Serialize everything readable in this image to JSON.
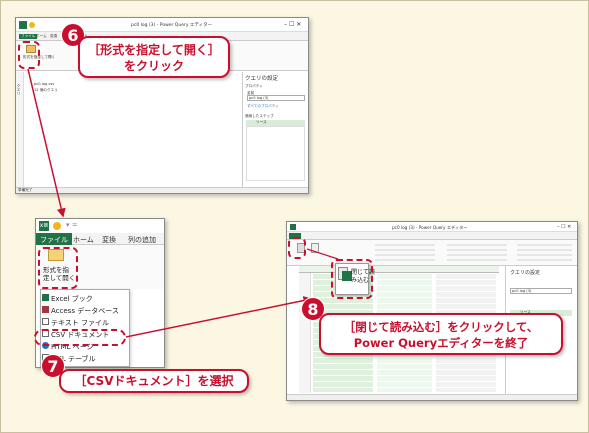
{
  "window1": {
    "title": "pc0 log (3) - Power Query エディター",
    "tabs": [
      "ファイル",
      "ホーム",
      "変換",
      "列の追加",
      "表示"
    ],
    "left_items": [
      "形式を指定して開く"
    ],
    "nav_labels": [
      "クエリ"
    ],
    "file_items": [
      "pc0-log.csv",
      "12 個のクエリ"
    ],
    "settings_title": "クエリの設定",
    "properties_label": "プロパティ",
    "name_label": "名前",
    "name_value": "pc0 log (3)",
    "all_properties": "すべてのプロパティ",
    "steps_label": "適用したステップ",
    "step_source": "ソース",
    "status": "準備完了"
  },
  "window2": {
    "title_left": "x≣",
    "tabs": [
      "ファイル",
      "ホーム",
      "変換",
      "列の追加"
    ],
    "open_as_label_1": "形式を指",
    "open_as_label_2": "定して開く",
    "menu": [
      {
        "label": "Excel ブック",
        "icon": "excel-icon",
        "color": "#1e7145"
      },
      {
        "label": "Access データベース",
        "icon": "access-icon",
        "color": "#a4373a"
      },
      {
        "label": "テキスト ファイル",
        "icon": "text-file-icon",
        "color": "#666666"
      },
      {
        "label": "CSV ドキュメント",
        "icon": "csv-icon",
        "color": "#666666"
      },
      {
        "label": "HTML ページ",
        "icon": "globe-icon",
        "color": "#2a6ebb"
      },
      {
        "label": "XML テーブル",
        "icon": "xml-icon",
        "color": "#666666"
      }
    ]
  },
  "window3": {
    "title": "pc0 log (3) - Power Query エディター",
    "close_load_label": "閉じて読み込む",
    "close_load_label_1": "閉じて読",
    "close_load_label_2": "み込む・",
    "settings_title": "クエリの設定",
    "name_value": "pc0 log (3)",
    "step_source": "ソース",
    "row_numbers": [
      "1",
      "2",
      "3",
      "4",
      "5",
      "6",
      "7",
      "8",
      "9",
      "10",
      "11",
      "12",
      "13",
      "14",
      "15",
      "16",
      "17",
      "18",
      "19",
      "20"
    ]
  },
  "callouts": {
    "step6_num": "6",
    "step6_line1": "［形式を指定して開く］",
    "step6_line2": "をクリック",
    "step7_num": "7",
    "step7_text": "［CSVドキュメント］を選択",
    "step8_num": "8",
    "step8_line1": "［閉じて読み込む］をクリックして、",
    "step8_line2": "Power Queryエディターを終了"
  },
  "colors": {
    "accent": "#c8102e",
    "background": "#fbf7e3",
    "excel_green": "#217346",
    "step_highlight": "#d9ecd9"
  }
}
